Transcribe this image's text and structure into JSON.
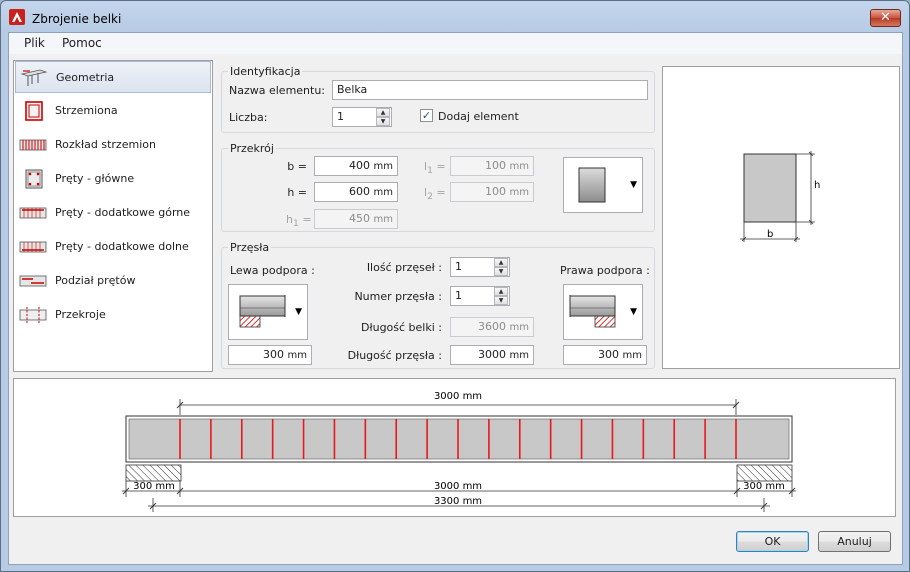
{
  "window": {
    "title": "Zbrojenie belki",
    "close_label": "✕"
  },
  "menu": {
    "items": [
      "Plik",
      "Pomoc"
    ]
  },
  "sidebar": {
    "items": [
      {
        "label": "Geometria",
        "icon": "geometry-icon",
        "active": true
      },
      {
        "label": "Strzemiona",
        "icon": "stirrups-icon",
        "active": false
      },
      {
        "label": "Rozkład strzemion",
        "icon": "stirrup-distribution-icon",
        "active": false
      },
      {
        "label": "Pręty - główne",
        "icon": "main-bars-icon",
        "active": false
      },
      {
        "label": "Pręty - dodatkowe górne",
        "icon": "top-bars-icon",
        "active": false
      },
      {
        "label": "Pręty - dodatkowe dolne",
        "icon": "bottom-bars-icon",
        "active": false
      },
      {
        "label": "Podział prętów",
        "icon": "bar-split-icon",
        "active": false
      },
      {
        "label": "Przekroje",
        "icon": "sections-icon",
        "active": false
      }
    ]
  },
  "identification": {
    "title": "Identyfikacja",
    "name_label": "Nazwa elementu:",
    "name_value": "Belka",
    "count_label": "Liczba:",
    "count_value": "1",
    "add_label": "Dodaj element",
    "add_checked": true
  },
  "section": {
    "title": "Przekrój",
    "b_label": "b =",
    "b_value": "400",
    "b_unit": "mm",
    "h_label": "h =",
    "h_value": "600",
    "h_unit": "mm",
    "h1_label": "h",
    "h1_sub": "1",
    "h1_eq": "=",
    "h1_value": "450",
    "h1_unit": "mm",
    "l1_label": "l",
    "l1_sub": "1",
    "l1_eq": "=",
    "l1_value": "100",
    "l1_unit": "mm",
    "l2_label": "l",
    "l2_sub": "2",
    "l2_eq": "=",
    "l2_value": "100",
    "l2_unit": "mm"
  },
  "spans": {
    "title": "Przęsła",
    "left_support_label": "Lewa podpora :",
    "right_support_label": "Prawa podpora :",
    "span_count_label": "Ilość przęseł :",
    "span_count_value": "1",
    "span_number_label": "Numer przęsła :",
    "span_number_value": "1",
    "beam_length_label": "Długość belki :",
    "beam_length_value": "3600",
    "beam_length_unit": "mm",
    "span_length_label": "Długość przęsła :",
    "span_length_value": "3000",
    "span_length_unit": "mm",
    "left_support_value": "300",
    "left_support_unit": "mm",
    "right_support_value": "300",
    "right_support_unit": "mm"
  },
  "preview": {
    "b_label": "b",
    "h_label": "h"
  },
  "beam_view": {
    "top_dim": "3000 mm",
    "clear_span_dim": "3000 mm",
    "left_support_dim": "300 mm",
    "right_support_dim": "300 mm",
    "total_dim": "3300 mm",
    "stirrup_count": 19
  },
  "buttons": {
    "ok": "OK",
    "cancel": "Anuluj"
  },
  "colors": {
    "stirrup": "#e8191c",
    "beam_fill": "#c8c8c8",
    "title_bar": "#b7cbe5"
  }
}
